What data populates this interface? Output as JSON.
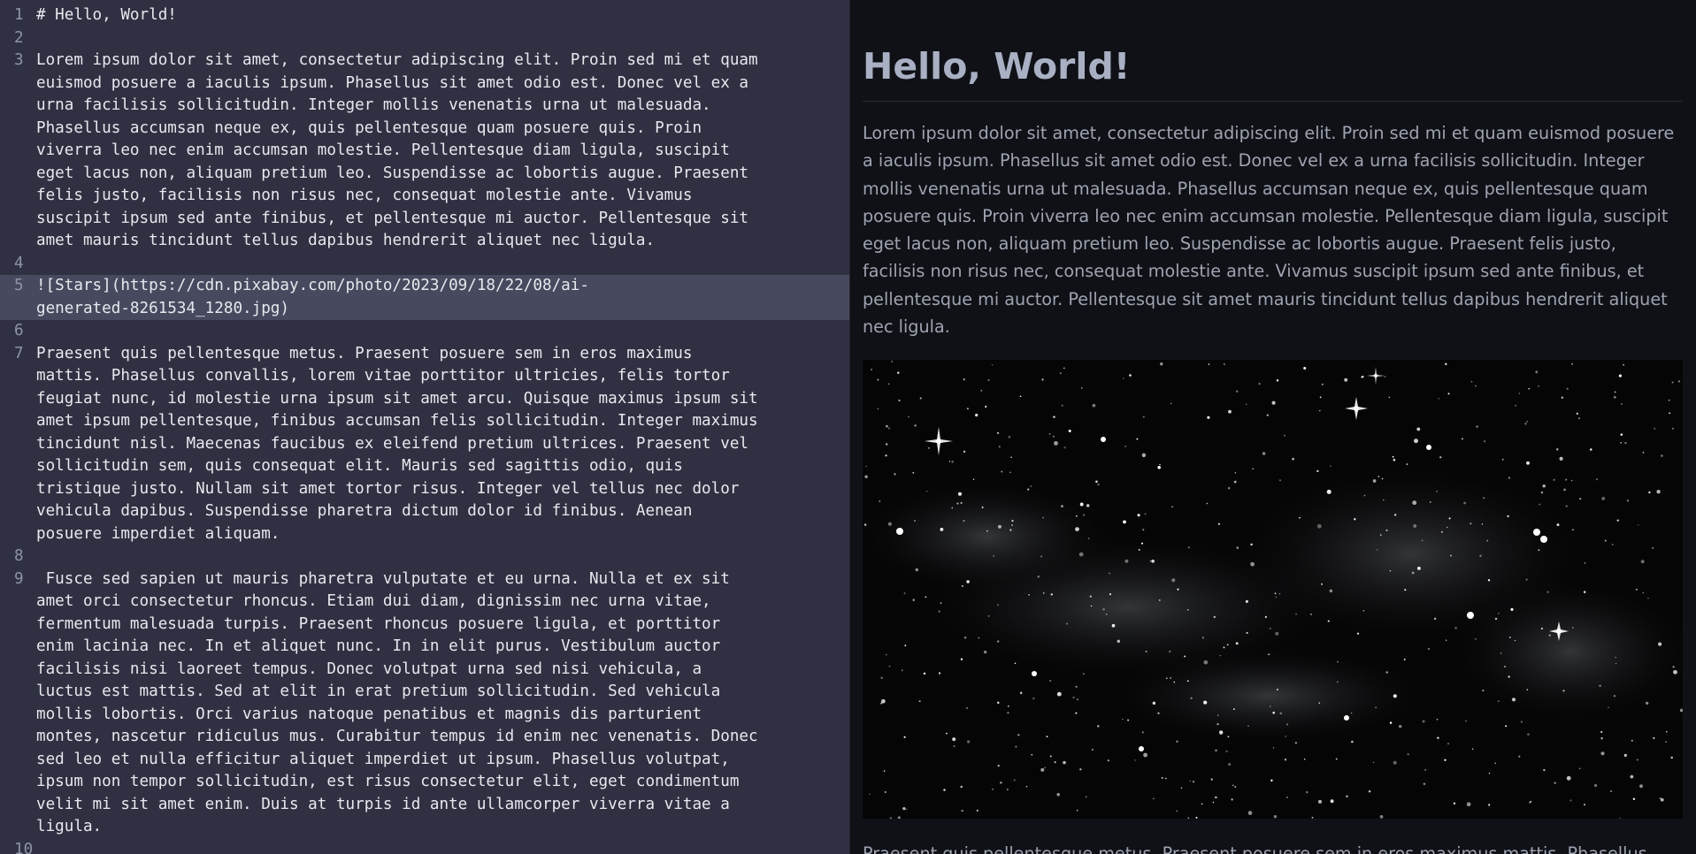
{
  "editor": {
    "lines": [
      {
        "num": "1",
        "text": "# Hello, World!"
      },
      {
        "num": "2",
        "text": ""
      },
      {
        "num": "3",
        "text": "Lorem ipsum dolor sit amet, consectetur adipiscing elit. Proin sed mi et quam\neuismod posuere a iaculis ipsum. Phasellus sit amet odio est. Donec vel ex a\nurna facilisis sollicitudin. Integer mollis venenatis urna ut malesuada.\nPhasellus accumsan neque ex, quis pellentesque quam posuere quis. Proin\nviverra leo nec enim accumsan molestie. Pellentesque diam ligula, suscipit\neget lacus non, aliquam pretium leo. Suspendisse ac lobortis augue. Praesent\nfelis justo, facilisis non risus nec, consequat molestie ante. Vivamus\nsuscipit ipsum sed ante finibus, et pellentesque mi auctor. Pellentesque sit\namet mauris tincidunt tellus dapibus hendrerit aliquet nec ligula."
      },
      {
        "num": "4",
        "text": ""
      },
      {
        "num": "5",
        "text": "![Stars](https://cdn.pixabay.com/photo/2023/09/18/22/08/ai-\ngenerated-8261534_1280.jpg)",
        "active": true
      },
      {
        "num": "6",
        "text": ""
      },
      {
        "num": "7",
        "text": "Praesent quis pellentesque metus. Praesent posuere sem in eros maximus\nmattis. Phasellus convallis, lorem vitae porttitor ultricies, felis tortor\nfeugiat nunc, id molestie urna ipsum sit amet arcu. Quisque maximus ipsum sit\namet ipsum pellentesque, finibus accumsan felis sollicitudin. Integer maximus\ntincidunt nisl. Maecenas faucibus ex eleifend pretium ultrices. Praesent vel\nsollicitudin sem, quis consequat elit. Mauris sed sagittis odio, quis\ntristique justo. Nullam sit amet tortor risus. Integer vel tellus nec dolor\nvehicula dapibus. Suspendisse pharetra dictum dolor id finibus. Aenean\nposuere imperdiet aliquam."
      },
      {
        "num": "8",
        "text": ""
      },
      {
        "num": "9",
        "text": " Fusce sed sapien ut mauris pharetra vulputate et eu urna. Nulla et ex sit\namet orci consectetur rhoncus. Etiam dui diam, dignissim nec urna vitae,\nfermentum malesuada turpis. Praesent rhoncus posuere ligula, et porttitor\nenim lacinia nec. In et aliquet nunc. In in elit purus. Vestibulum auctor\nfacilisis nisi laoreet tempus. Donec volutpat urna sed nisi vehicula, a\nluctus est mattis. Sed at elit in erat pretium sollicitudin. Sed vehicula\nmollis lobortis. Orci varius natoque penatibus et magnis dis parturient\nmontes, nascetur ridiculus mus. Curabitur tempus id enim nec venenatis. Donec\nsed leo et nulla efficitur aliquet imperdiet ut ipsum. Phasellus volutpat,\nipsum non tempor sollicitudin, est risus consectetur elit, eget condimentum\nvelit mi sit amet enim. Duis at turpis id ante ullamcorper viverra vitae a\nligula."
      },
      {
        "num": "10",
        "text": ""
      }
    ]
  },
  "preview": {
    "title": "Hello, World!",
    "paragraph1": "Lorem ipsum dolor sit amet, consectetur adipiscing elit. Proin sed mi et quam euismod posuere a iaculis ipsum. Phasellus sit amet odio est. Donec vel ex a urna facilisis sollicitudin. Integer mollis venenatis urna ut malesuada. Phasellus accumsan neque ex, quis pellentesque quam posuere quis. Proin viverra leo nec enim accumsan molestie. Pellentesque diam ligula, suscipit eget lacus non, aliquam pretium leo. Suspendisse ac lobortis augue. Praesent felis justo, facilisis non risus nec, consequat molestie ante. Vivamus suscipit ipsum sed ante finibus, et pellentesque mi auctor. Pellentesque sit amet mauris tincidunt tellus dapibus hendrerit aliquet nec ligula.",
    "image_alt": "Stars",
    "paragraph2": "Praesent quis pellentesque metus. Praesent posuere sem in eros maximus mattis. Phasellus"
  },
  "colors": {
    "editor_bg": "#2f3142",
    "active_line": "#474a5e",
    "preview_bg": "#0f1117",
    "heading": "#a9b0c3",
    "body_text": "#9ea3b0"
  }
}
